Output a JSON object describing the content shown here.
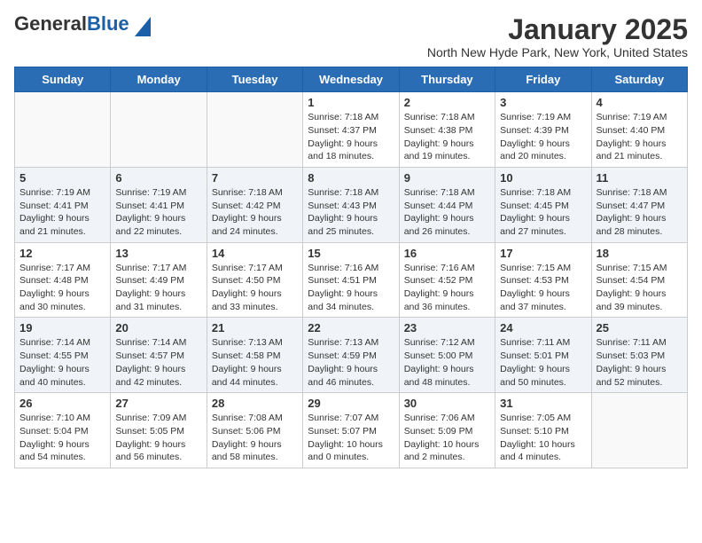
{
  "header": {
    "logo_general": "General",
    "logo_blue": "Blue",
    "month": "January 2025",
    "location": "North New Hyde Park, New York, United States"
  },
  "weekdays": [
    "Sunday",
    "Monday",
    "Tuesday",
    "Wednesday",
    "Thursday",
    "Friday",
    "Saturday"
  ],
  "weeks": [
    [
      {
        "day": "",
        "info": ""
      },
      {
        "day": "",
        "info": ""
      },
      {
        "day": "",
        "info": ""
      },
      {
        "day": "1",
        "info": "Sunrise: 7:18 AM\nSunset: 4:37 PM\nDaylight: 9 hours\nand 18 minutes."
      },
      {
        "day": "2",
        "info": "Sunrise: 7:18 AM\nSunset: 4:38 PM\nDaylight: 9 hours\nand 19 minutes."
      },
      {
        "day": "3",
        "info": "Sunrise: 7:19 AM\nSunset: 4:39 PM\nDaylight: 9 hours\nand 20 minutes."
      },
      {
        "day": "4",
        "info": "Sunrise: 7:19 AM\nSunset: 4:40 PM\nDaylight: 9 hours\nand 21 minutes."
      }
    ],
    [
      {
        "day": "5",
        "info": "Sunrise: 7:19 AM\nSunset: 4:41 PM\nDaylight: 9 hours\nand 21 minutes."
      },
      {
        "day": "6",
        "info": "Sunrise: 7:19 AM\nSunset: 4:41 PM\nDaylight: 9 hours\nand 22 minutes."
      },
      {
        "day": "7",
        "info": "Sunrise: 7:18 AM\nSunset: 4:42 PM\nDaylight: 9 hours\nand 24 minutes."
      },
      {
        "day": "8",
        "info": "Sunrise: 7:18 AM\nSunset: 4:43 PM\nDaylight: 9 hours\nand 25 minutes."
      },
      {
        "day": "9",
        "info": "Sunrise: 7:18 AM\nSunset: 4:44 PM\nDaylight: 9 hours\nand 26 minutes."
      },
      {
        "day": "10",
        "info": "Sunrise: 7:18 AM\nSunset: 4:45 PM\nDaylight: 9 hours\nand 27 minutes."
      },
      {
        "day": "11",
        "info": "Sunrise: 7:18 AM\nSunset: 4:47 PM\nDaylight: 9 hours\nand 28 minutes."
      }
    ],
    [
      {
        "day": "12",
        "info": "Sunrise: 7:17 AM\nSunset: 4:48 PM\nDaylight: 9 hours\nand 30 minutes."
      },
      {
        "day": "13",
        "info": "Sunrise: 7:17 AM\nSunset: 4:49 PM\nDaylight: 9 hours\nand 31 minutes."
      },
      {
        "day": "14",
        "info": "Sunrise: 7:17 AM\nSunset: 4:50 PM\nDaylight: 9 hours\nand 33 minutes."
      },
      {
        "day": "15",
        "info": "Sunrise: 7:16 AM\nSunset: 4:51 PM\nDaylight: 9 hours\nand 34 minutes."
      },
      {
        "day": "16",
        "info": "Sunrise: 7:16 AM\nSunset: 4:52 PM\nDaylight: 9 hours\nand 36 minutes."
      },
      {
        "day": "17",
        "info": "Sunrise: 7:15 AM\nSunset: 4:53 PM\nDaylight: 9 hours\nand 37 minutes."
      },
      {
        "day": "18",
        "info": "Sunrise: 7:15 AM\nSunset: 4:54 PM\nDaylight: 9 hours\nand 39 minutes."
      }
    ],
    [
      {
        "day": "19",
        "info": "Sunrise: 7:14 AM\nSunset: 4:55 PM\nDaylight: 9 hours\nand 40 minutes."
      },
      {
        "day": "20",
        "info": "Sunrise: 7:14 AM\nSunset: 4:57 PM\nDaylight: 9 hours\nand 42 minutes."
      },
      {
        "day": "21",
        "info": "Sunrise: 7:13 AM\nSunset: 4:58 PM\nDaylight: 9 hours\nand 44 minutes."
      },
      {
        "day": "22",
        "info": "Sunrise: 7:13 AM\nSunset: 4:59 PM\nDaylight: 9 hours\nand 46 minutes."
      },
      {
        "day": "23",
        "info": "Sunrise: 7:12 AM\nSunset: 5:00 PM\nDaylight: 9 hours\nand 48 minutes."
      },
      {
        "day": "24",
        "info": "Sunrise: 7:11 AM\nSunset: 5:01 PM\nDaylight: 9 hours\nand 50 minutes."
      },
      {
        "day": "25",
        "info": "Sunrise: 7:11 AM\nSunset: 5:03 PM\nDaylight: 9 hours\nand 52 minutes."
      }
    ],
    [
      {
        "day": "26",
        "info": "Sunrise: 7:10 AM\nSunset: 5:04 PM\nDaylight: 9 hours\nand 54 minutes."
      },
      {
        "day": "27",
        "info": "Sunrise: 7:09 AM\nSunset: 5:05 PM\nDaylight: 9 hours\nand 56 minutes."
      },
      {
        "day": "28",
        "info": "Sunrise: 7:08 AM\nSunset: 5:06 PM\nDaylight: 9 hours\nand 58 minutes."
      },
      {
        "day": "29",
        "info": "Sunrise: 7:07 AM\nSunset: 5:07 PM\nDaylight: 10 hours\nand 0 minutes."
      },
      {
        "day": "30",
        "info": "Sunrise: 7:06 AM\nSunset: 5:09 PM\nDaylight: 10 hours\nand 2 minutes."
      },
      {
        "day": "31",
        "info": "Sunrise: 7:05 AM\nSunset: 5:10 PM\nDaylight: 10 hours\nand 4 minutes."
      },
      {
        "day": "",
        "info": ""
      }
    ]
  ]
}
